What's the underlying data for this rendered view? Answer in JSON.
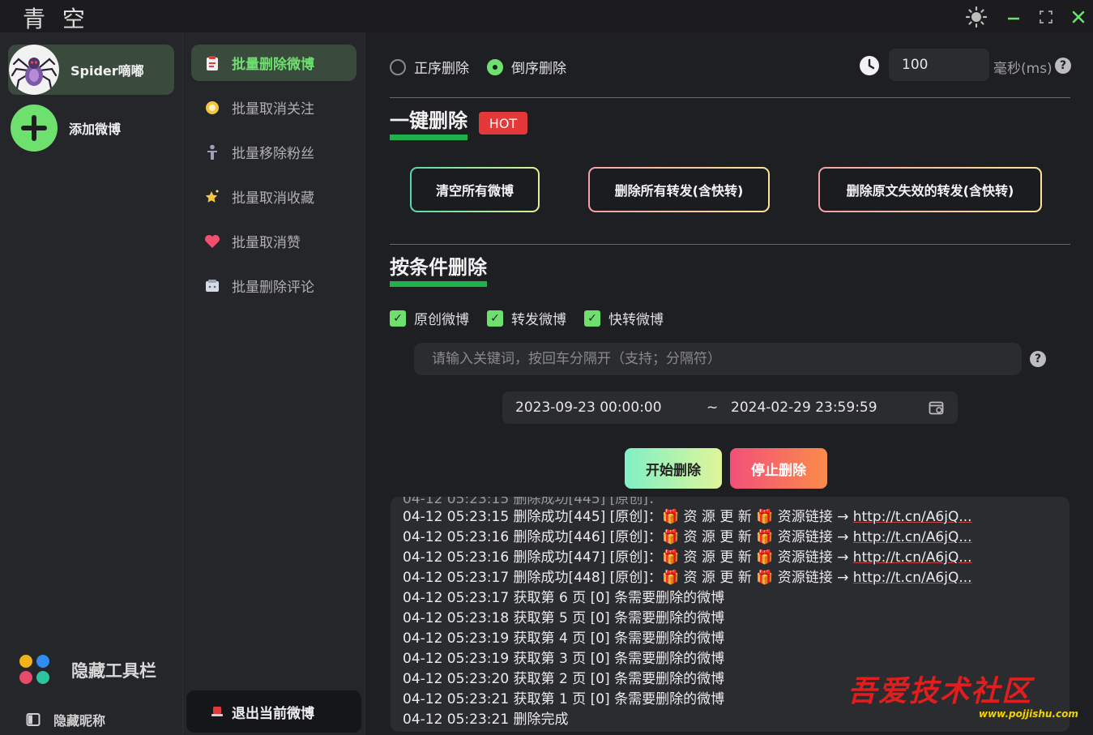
{
  "app": {
    "title": "青 空"
  },
  "accounts": [
    {
      "label": "Spider嘀嘟",
      "active": true
    },
    {
      "label": "添加微博",
      "active": false
    }
  ],
  "sidebar_footer": {
    "toolbar_label": "隐藏工具栏",
    "nickname_label": "隐藏昵称"
  },
  "nav": {
    "items": [
      {
        "label": "批量删除微博",
        "icon": "clipboard-icon",
        "active": true
      },
      {
        "label": "批量取消关注",
        "icon": "bulb-icon",
        "active": false
      },
      {
        "label": "批量移除粉丝",
        "icon": "person-icon",
        "active": false
      },
      {
        "label": "批量取消收藏",
        "icon": "star-icon",
        "active": false
      },
      {
        "label": "批量取消赞",
        "icon": "heart-icon",
        "active": false
      },
      {
        "label": "批量删除评论",
        "icon": "comment-icon",
        "active": false
      }
    ],
    "logout_label": "退出当前微博"
  },
  "order": {
    "options": [
      "正序删除",
      "倒序删除"
    ],
    "selected": "倒序删除"
  },
  "delay": {
    "value": "100",
    "unit": "毫秒(ms)"
  },
  "one_click": {
    "title": "一键删除",
    "badge": "HOT",
    "buttons": [
      "清空所有微博",
      "删除所有转发(含快转)",
      "删除原文失效的转发(含快转)"
    ]
  },
  "conditional": {
    "title": "按条件删除",
    "checkboxes": [
      {
        "label": "原创微博",
        "checked": true
      },
      {
        "label": "转发微博",
        "checked": true
      },
      {
        "label": "快转微博",
        "checked": true
      }
    ],
    "keyword_placeholder": "请输入关键词，按回车分隔开（支持；分隔符）",
    "date_start": "2023-09-23 00:00:00",
    "date_sep": "~",
    "date_end": "2024-02-29 23:59:59",
    "start_label": "开始删除",
    "stop_label": "停止删除"
  },
  "log": {
    "lines": [
      {
        "prefix": "04-12 05:23:15 删除成功[445] [原创]：",
        "body": " 资 源 更 新 ",
        "tail": " 资源链接 → ",
        "link": "http://t.cn/A6jQ..."
      },
      {
        "prefix": "04-12 05:23:16 删除成功[446] [原创]：",
        "body": " 资 源 更 新 ",
        "tail": " 资源链接 → ",
        "link": "http://t.cn/A6jQ..."
      },
      {
        "prefix": "04-12 05:23:16 删除成功[447] [原创]：",
        "body": " 资 源 更 新 ",
        "tail": " 资源链接 → ",
        "link": "http://t.cn/A6jQ..."
      },
      {
        "prefix": "04-12 05:23:17 删除成功[448] [原创]：",
        "body": " 资 源 更 新 ",
        "tail": " 资源链接 → ",
        "link": "http://t.cn/A6jQ..."
      },
      {
        "prefix": "04-12 05:23:17 获取第 6 页 [0] 条需要删除的微博"
      },
      {
        "prefix": "04-12 05:23:18 获取第 5 页 [0] 条需要删除的微博"
      },
      {
        "prefix": "04-12 05:23:19 获取第 4 页 [0] 条需要删除的微博"
      },
      {
        "prefix": "04-12 05:23:19 获取第 3 页 [0] 条需要删除的微博"
      },
      {
        "prefix": "04-12 05:23:20 获取第 2 页 [0] 条需要删除的微博"
      },
      {
        "prefix": "04-12 05:23:21 获取第 1 页 [0] 条需要删除的微博"
      },
      {
        "prefix": "04-12 05:23:21 删除完成"
      }
    ]
  },
  "watermark": {
    "text": "吾爱技术社区",
    "url": "www.pojjishu.com"
  },
  "colors": {
    "accent": "#6ee06e",
    "hot": "#e53939",
    "underline": "#1fb14a"
  }
}
